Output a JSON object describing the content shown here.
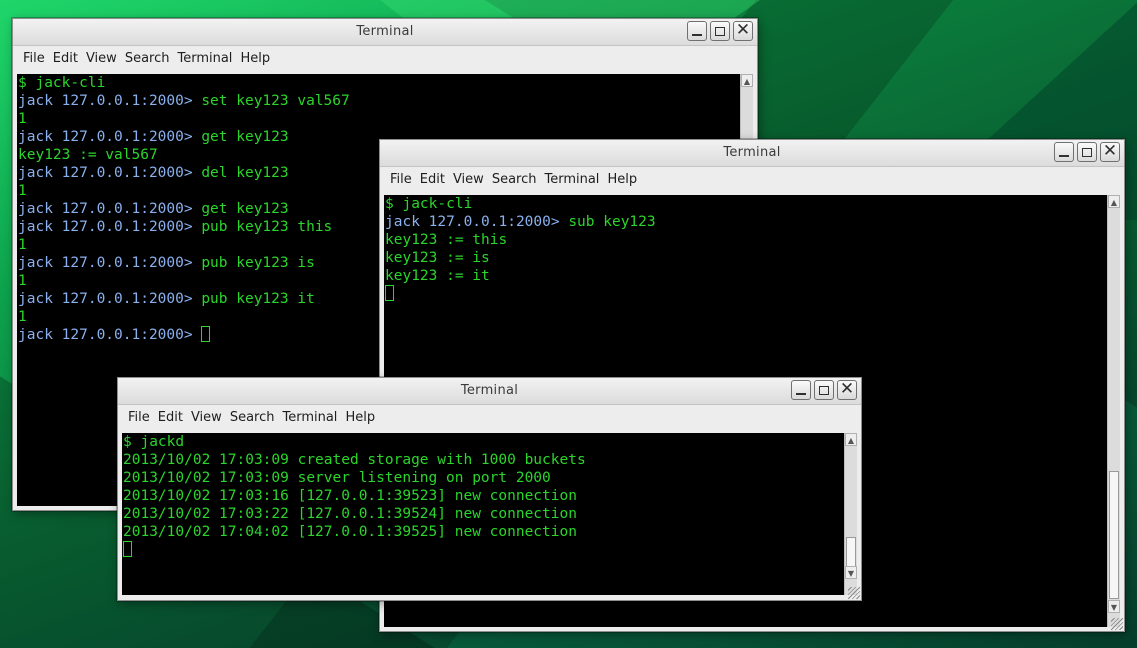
{
  "menu": [
    "File",
    "Edit",
    "View",
    "Search",
    "Terminal",
    "Help"
  ],
  "windows": {
    "cli1": {
      "title": "Terminal",
      "lines": [
        [
          {
            "t": "$ jack-cli",
            "c": "green"
          }
        ],
        [
          {
            "t": "jack 127.0.0.1:2000> ",
            "c": "blue"
          },
          {
            "t": "set key123 val567",
            "c": "green"
          }
        ],
        [
          {
            "t": "1",
            "c": "green"
          }
        ],
        [
          {
            "t": "jack 127.0.0.1:2000> ",
            "c": "blue"
          },
          {
            "t": "get key123",
            "c": "green"
          }
        ],
        [
          {
            "t": "key123 := val567",
            "c": "green"
          }
        ],
        [
          {
            "t": "jack 127.0.0.1:2000> ",
            "c": "blue"
          },
          {
            "t": "del key123",
            "c": "green"
          }
        ],
        [
          {
            "t": "1",
            "c": "green"
          }
        ],
        [
          {
            "t": "jack 127.0.0.1:2000> ",
            "c": "blue"
          },
          {
            "t": "get key123",
            "c": "green"
          }
        ],
        [
          {
            "t": "jack 127.0.0.1:2000> ",
            "c": "blue"
          },
          {
            "t": "pub key123 this",
            "c": "green"
          }
        ],
        [
          {
            "t": "1",
            "c": "green"
          }
        ],
        [
          {
            "t": "jack 127.0.0.1:2000> ",
            "c": "blue"
          },
          {
            "t": "pub key123 is",
            "c": "green"
          }
        ],
        [
          {
            "t": "1",
            "c": "green"
          }
        ],
        [
          {
            "t": "jack 127.0.0.1:2000> ",
            "c": "blue"
          },
          {
            "t": "pub key123 it",
            "c": "green"
          }
        ],
        [
          {
            "t": "1",
            "c": "green"
          }
        ],
        [
          {
            "t": "jack 127.0.0.1:2000> ",
            "c": "blue"
          },
          {
            "cursor": true
          }
        ]
      ]
    },
    "cli2": {
      "title": "Terminal",
      "lines": [
        [
          {
            "t": "$ jack-cli",
            "c": "green"
          }
        ],
        [
          {
            "t": "jack 127.0.0.1:2000> ",
            "c": "blue"
          },
          {
            "t": "sub key123",
            "c": "green"
          }
        ],
        [
          {
            "t": "key123 := this",
            "c": "green"
          }
        ],
        [
          {
            "t": "key123 := is",
            "c": "green"
          }
        ],
        [
          {
            "t": "key123 := it",
            "c": "green"
          }
        ],
        [
          {
            "cursor": true
          }
        ]
      ]
    },
    "server": {
      "title": "Terminal",
      "lines": [
        [
          {
            "t": "$ jackd",
            "c": "green"
          }
        ],
        [
          {
            "t": "2013/10/02 17:03:09 created storage with 1000 buckets",
            "c": "green"
          }
        ],
        [
          {
            "t": "2013/10/02 17:03:09 server listening on port 2000",
            "c": "green"
          }
        ],
        [
          {
            "t": "2013/10/02 17:03:16 [127.0.0.1:39523] new connection",
            "c": "green"
          }
        ],
        [
          {
            "t": "2013/10/02 17:03:22 [127.0.0.1:39524] new connection",
            "c": "green"
          }
        ],
        [
          {
            "t": "2013/10/02 17:04:02 [127.0.0.1:39525] new connection",
            "c": "green"
          }
        ],
        [
          {
            "cursor": true
          }
        ]
      ]
    }
  },
  "colors": {
    "prompt": "#8ab0ee",
    "text": "#2bd52b",
    "terminal_bg": "#000000"
  },
  "icons": [
    "minimize-icon",
    "maximize-icon",
    "close-icon",
    "scroll-up-icon",
    "scroll-down-icon",
    "resize-grip-icon"
  ]
}
